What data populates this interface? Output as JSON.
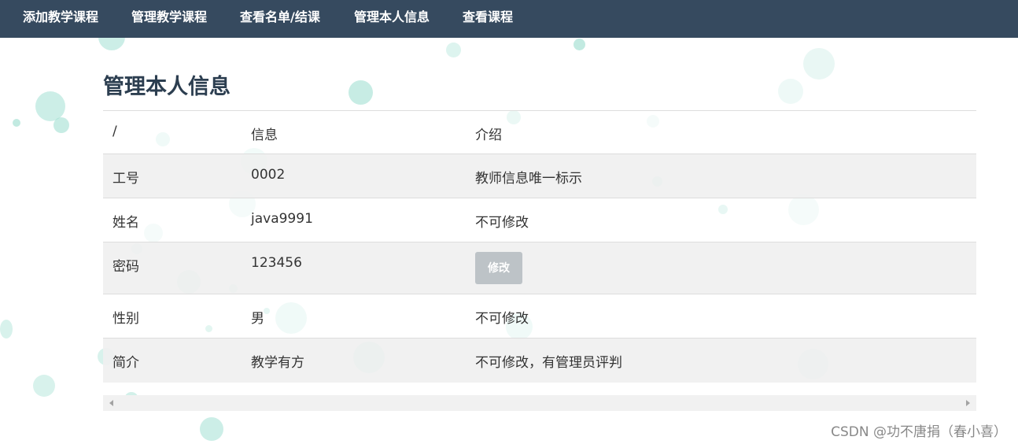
{
  "navbar": {
    "items": [
      {
        "label": "添加教学课程"
      },
      {
        "label": "管理教学课程"
      },
      {
        "label": "查看名单/结课"
      },
      {
        "label": "管理本人信息"
      },
      {
        "label": "查看课程"
      }
    ]
  },
  "page": {
    "title": "管理本人信息"
  },
  "table": {
    "headers": [
      "/",
      "信息",
      "介绍"
    ],
    "rows": [
      {
        "field": "工号",
        "value": "0002",
        "note": "教师信息唯一标示"
      },
      {
        "field": "姓名",
        "value": "java9991",
        "note": "不可修改"
      },
      {
        "field": "密码",
        "value": "123456",
        "action": "修改"
      },
      {
        "field": "性别",
        "value": "男",
        "note": "不可修改"
      },
      {
        "field": "简介",
        "value": "教学有方",
        "note": "不可修改，有管理员评判"
      }
    ]
  },
  "watermark": "CSDN @功不唐捐（春小喜）",
  "colors": {
    "navbar_bg": "#364a5f",
    "title": "#2c3e50",
    "stripe": "#f0f0f0",
    "button": "#bdc3c7",
    "bubble": "#8fd9c9"
  }
}
